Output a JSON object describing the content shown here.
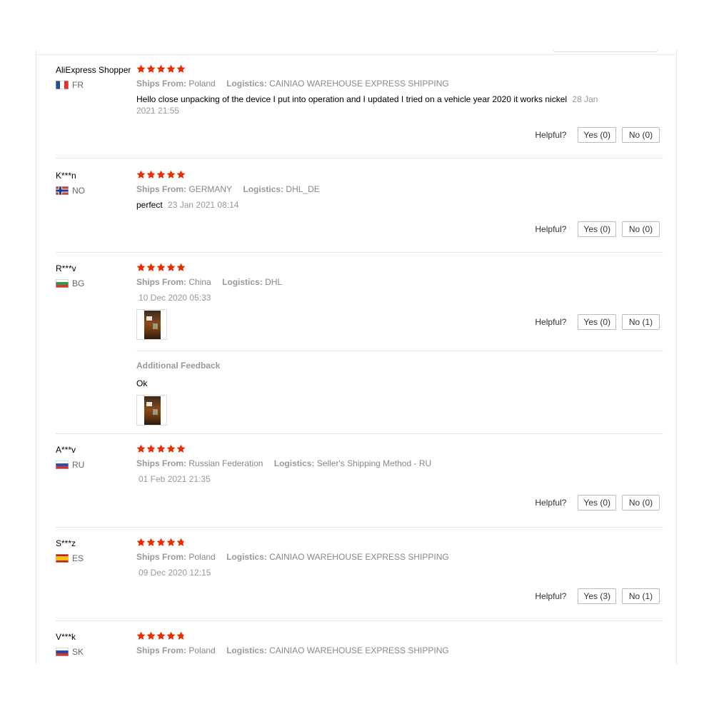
{
  "labels": {
    "ships_from": "Ships From:",
    "logistics": "Logistics:",
    "helpful": "Helpful?",
    "additional_feedback": "Additional Feedback"
  },
  "colors": {
    "star": "#e62e04",
    "border": "#e5e5e5"
  },
  "reviews": [
    {
      "user": "AliExpress Shopper",
      "country": "FR",
      "flag": "flag-france",
      "rating": 5,
      "ships_from": "Poland",
      "logistics": "CAINIAO WAREHOUSE EXPRESS SHIPPING",
      "text": "Hello close unpacking of the device I put into operation and I updated I tried on a vehicle year 2020 it works nickel",
      "date": "28 Jan 2021 21:55",
      "yes": "Yes (0)",
      "no": "No (0)"
    },
    {
      "user": "K***n",
      "country": "NO",
      "flag": "flag-norway",
      "rating": 5,
      "ships_from": "GERMANY",
      "logistics": "DHL_DE",
      "text": "perfect",
      "date": "23 Jan 2021 08:14",
      "yes": "Yes (0)",
      "no": "No (0)"
    },
    {
      "user": "R***v",
      "country": "BG",
      "flag": "flag-bulgaria",
      "rating": 5,
      "ships_from": "China",
      "logistics": "DHL",
      "date": "10 Dec 2020 05:33",
      "yes": "Yes (0)",
      "no": "No (1)",
      "additional_text": "Ok"
    },
    {
      "user": "A***v",
      "country": "RU",
      "flag": "flag-russia",
      "rating": 5,
      "ships_from": "Russian Federation",
      "logistics": "Seller's Shipping Method - RU",
      "date": "01 Feb 2021 21:35",
      "yes": "Yes (0)",
      "no": "No (0)"
    },
    {
      "user": "S***z",
      "country": "ES",
      "flag": "flag-spain",
      "rating": 4.8,
      "ships_from": "Poland",
      "logistics": "CAINIAO WAREHOUSE EXPRESS SHIPPING",
      "date": "09 Dec 2020 12:15",
      "yes": "Yes (3)",
      "no": "No (1)"
    },
    {
      "user": "V***k",
      "country": "SK",
      "flag": "flag-slovakia",
      "rating": 4.8,
      "ships_from": "Poland",
      "logistics": "CAINIAO WAREHOUSE EXPRESS SHIPPING"
    }
  ]
}
